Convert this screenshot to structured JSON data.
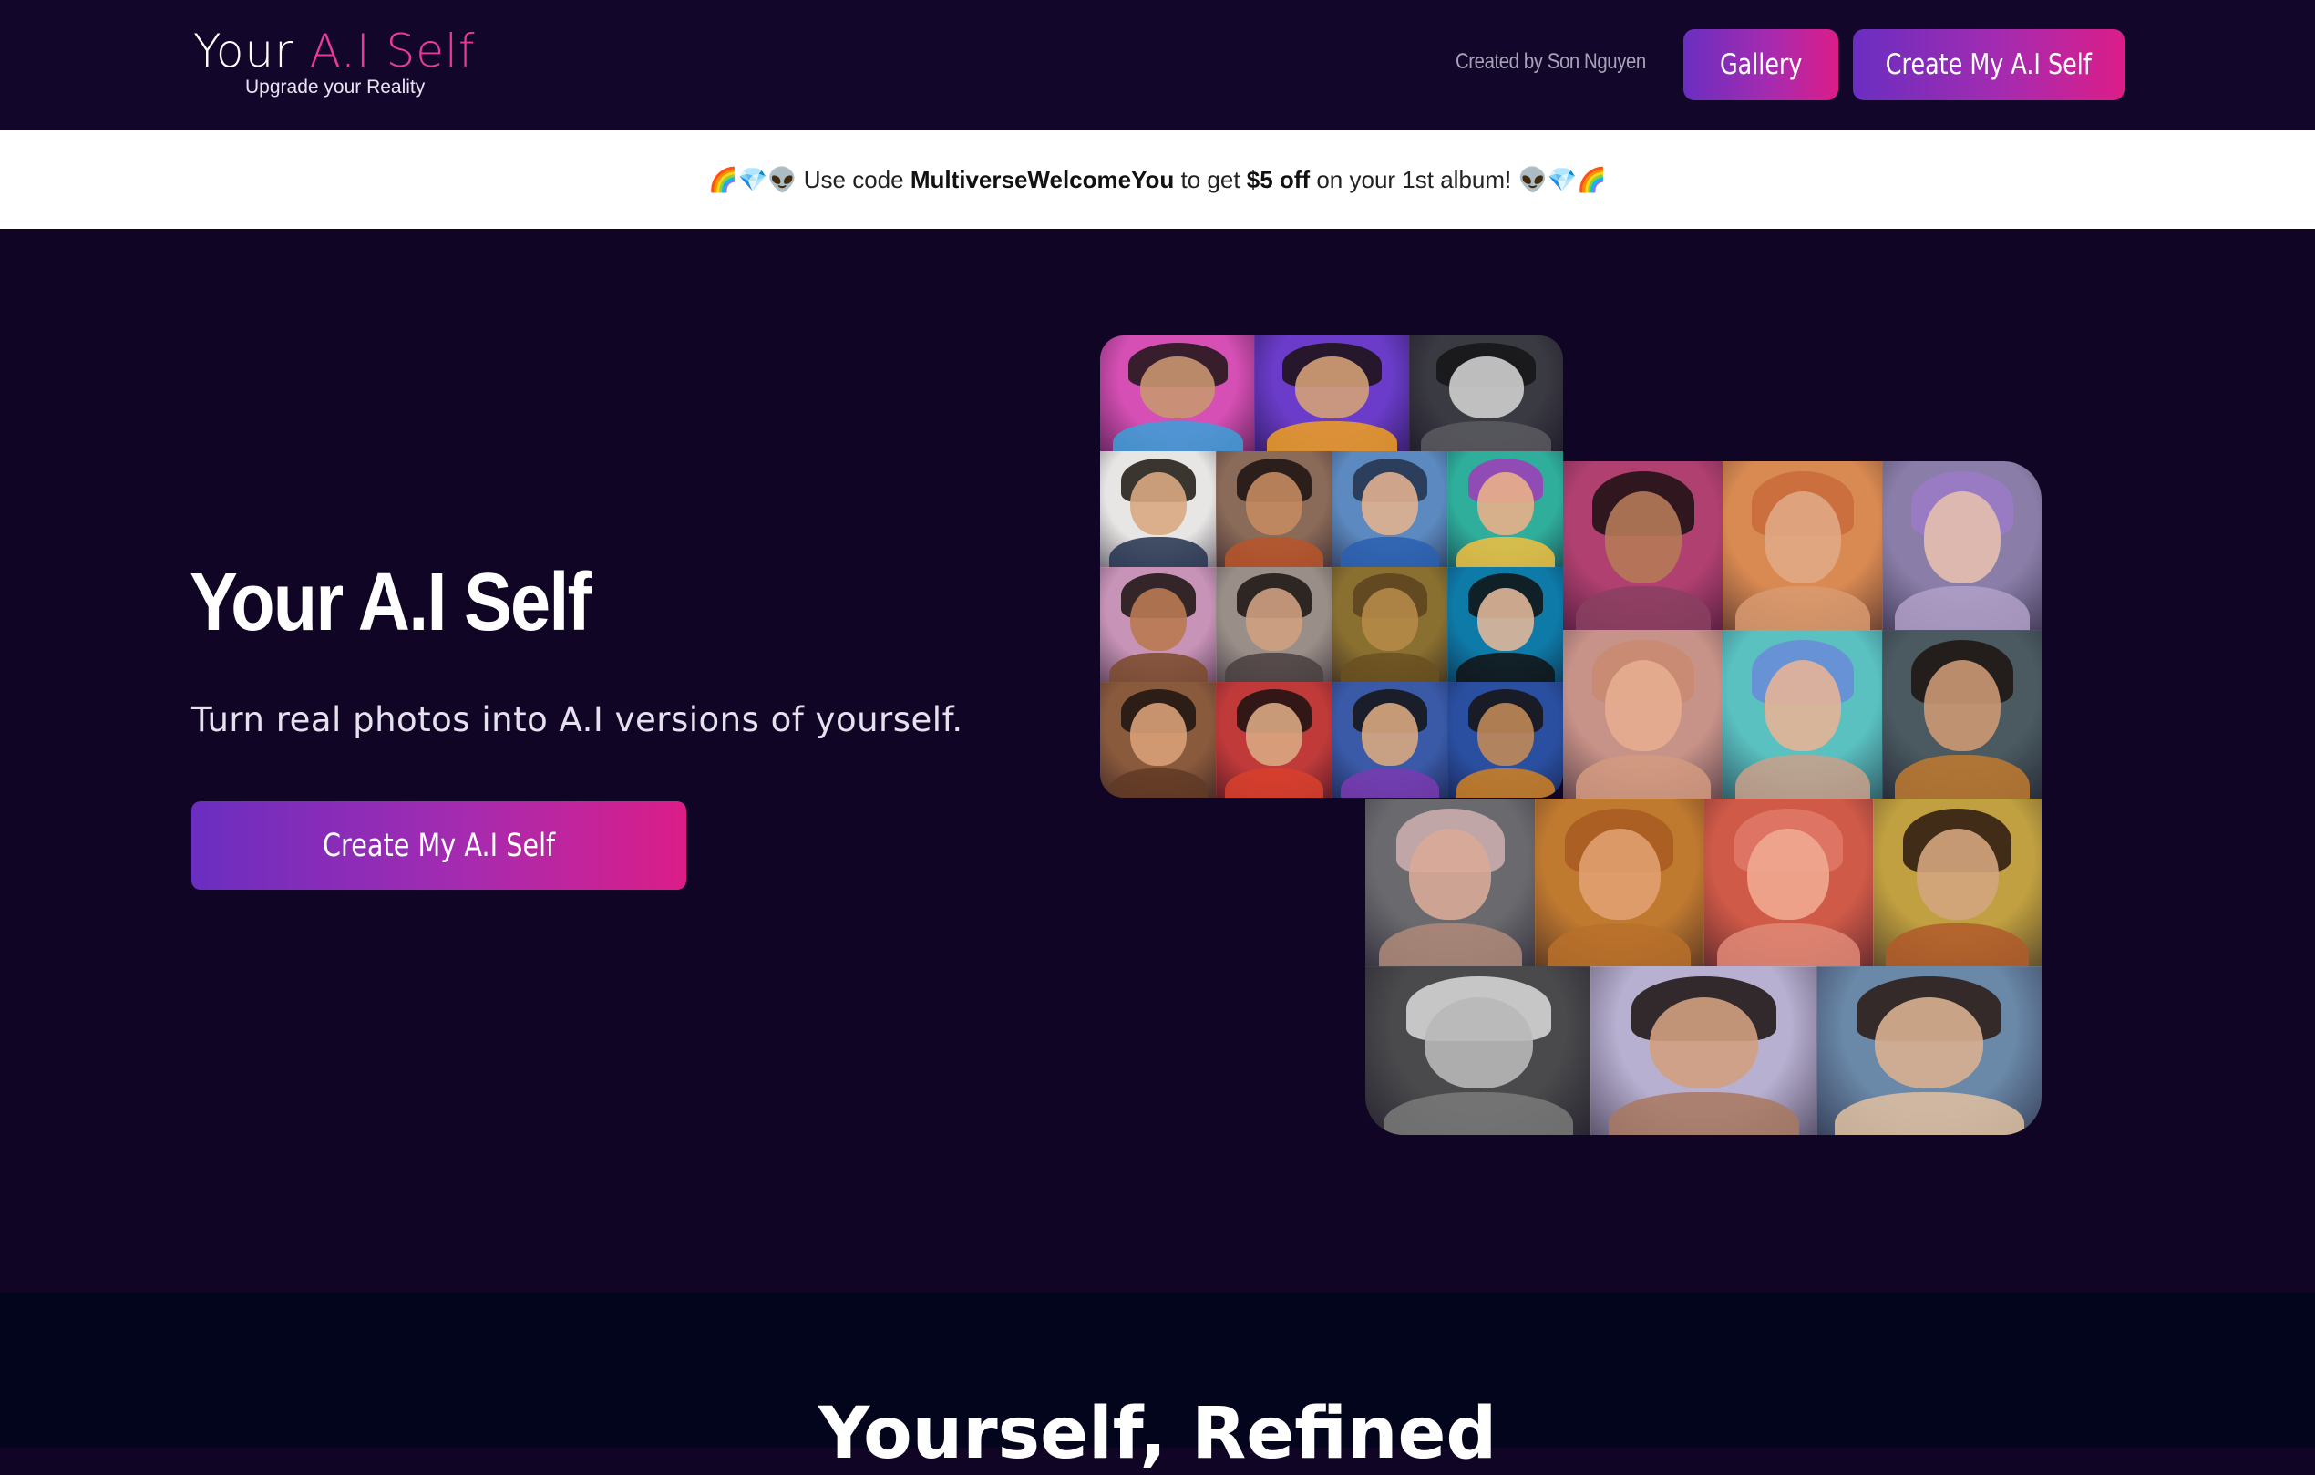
{
  "header": {
    "logo_prefix": "Your ",
    "logo_accent": "A.I Self",
    "tagline": "Upgrade your Reality",
    "credit": "Created by Son Nguyen",
    "gallery_label": "Gallery",
    "create_label": "Create My A.I Self"
  },
  "promo": {
    "emoji_left": "🌈💎👽",
    "text_1": " Use code ",
    "code": "MultiverseWelcomeYou",
    "text_2": " to get ",
    "discount": "$5 off",
    "text_3": " on your 1st album! ",
    "emoji_right": "👽💎🌈"
  },
  "hero": {
    "title": "Your A.I Self",
    "subtitle": "Turn real photos into A.I versions of yourself.",
    "cta_label": "Create My A.I Self"
  },
  "gallery_small": {
    "top_row": [
      {
        "bg": "#d64fb4",
        "face": "#c99670",
        "hair": "#1c1414",
        "body": "#3aa0d8"
      },
      {
        "bg": "#6a3cc9",
        "face": "#d4a077",
        "hair": "#1a1010",
        "body": "#f0a020"
      },
      {
        "bg": "#3a3a42",
        "face": "#cfcfcf",
        "hair": "#151515",
        "body": "#5a5a60"
      }
    ],
    "grid": [
      {
        "bg": "#e8e6e4",
        "face": "#d9a982",
        "hair": "#1c1510",
        "body": "#22314e"
      },
      {
        "bg": "#8a6a58",
        "face": "#c48b60",
        "hair": "#1a1010",
        "body": "#b8552a"
      },
      {
        "bg": "#5c8ac0",
        "face": "#e0b08f",
        "hair": "#22304a",
        "body": "#2a5fb0"
      },
      {
        "bg": "#2fae9c",
        "face": "#e9b08a",
        "hair": "#a13ab8",
        "body": "#f2c040"
      },
      {
        "bg": "#c793b6",
        "face": "#b97a52",
        "hair": "#1a1210",
        "body": "#7a4a2c"
      },
      {
        "bg": "#9a8f88",
        "face": "#cfa081",
        "hair": "#1a1410",
        "body": "#4a4040"
      },
      {
        "bg": "#8a7030",
        "face": "#b48a48",
        "hair": "#5c4220",
        "body": "#6a5020"
      },
      {
        "bg": "#0e7aa8",
        "face": "#e0b69a",
        "hair": "#101010",
        "body": "#121212"
      },
      {
        "bg": "#8a5a3c",
        "face": "#d8a078",
        "hair": "#1b1410",
        "body": "#603a24"
      },
      {
        "bg": "#c03a3a",
        "face": "#d9a882",
        "hair": "#1a1210",
        "body": "#d8402c"
      },
      {
        "bg": "#3a5aa8",
        "face": "#d8a77f",
        "hair": "#141414",
        "body": "#7a3ab0"
      },
      {
        "bg": "#2a4fa0",
        "face": "#c08858",
        "hair": "#161210",
        "body": "#d08020"
      }
    ]
  },
  "gallery_big": {
    "row1": [
      {
        "bg": "#b04070",
        "face": "#b67a58",
        "hair": "#1a1010",
        "body": "#8a4060"
      },
      {
        "bg": "#d98a52",
        "face": "#e0a884",
        "hair": "#c86a3c",
        "body": "#d89a70"
      },
      {
        "bg": "#8a7ea8",
        "face": "#e4bfae",
        "hair": "#9a7ac8",
        "body": "#b0a0c8"
      }
    ],
    "row2": [
      {
        "bg": "#c79288",
        "face": "#e6ad90",
        "hair": "#c98a70",
        "body": "#d49a80"
      },
      {
        "bg": "#5ac0c0",
        "face": "#e4b497",
        "hair": "#6a8ad8",
        "body": "#caa08a"
      },
      {
        "bg": "#4a5a60",
        "face": "#cc9874",
        "hair": "#1c1410",
        "body": "#c07a30"
      }
    ],
    "row3": [
      {
        "bg": "#6a6a6e",
        "face": "#d8aa98",
        "hair": "#cfb0b0",
        "body": "#b08a7a"
      },
      {
        "bg": "#c07a30",
        "face": "#e0a070",
        "hair": "#a85a20",
        "body": "#b8702a"
      },
      {
        "bg": "#d05a48",
        "face": "#f0a890",
        "hair": "#e07a6a",
        "body": "#e08a78"
      },
      {
        "bg": "#c0a040",
        "face": "#d3a57d",
        "hair": "#2a1810",
        "body": "#b05a2a"
      }
    ],
    "row4": [
      {
        "bg": "#4a4a4c",
        "face": "#b8b8b8",
        "hair": "#dcdcdc",
        "body": "#7a7a7a"
      },
      {
        "bg": "#b8b0d0",
        "face": "#d0a080",
        "hair": "#1a1210",
        "body": "#a87860"
      },
      {
        "bg": "#6a88a8",
        "face": "#d8b090",
        "hair": "#2a1a14",
        "body": "#e0c0a0"
      }
    ]
  },
  "section2": {
    "title": "Yourself, Refined"
  }
}
